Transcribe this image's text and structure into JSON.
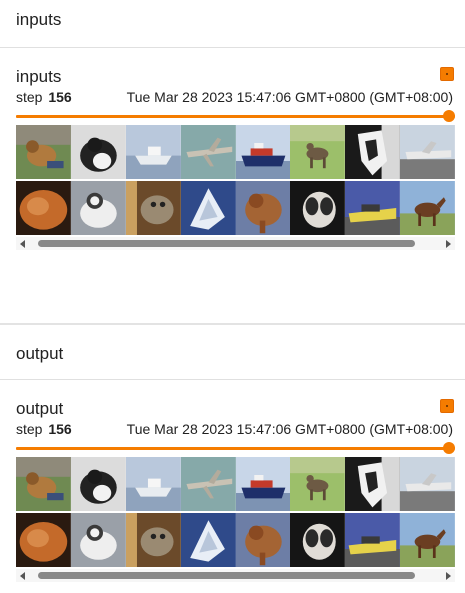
{
  "sections": [
    {
      "header": "inputs",
      "card": {
        "title": "inputs",
        "step_label": "step",
        "step_value": "156",
        "timestamp": "Tue Mar 28 2023 15:47:06 GMT+0800 (GMT+08:00)",
        "slider_fraction": 1.0,
        "images": [
          "dog on grass",
          "black and white dog",
          "boat",
          "airplane",
          "ship",
          "deer",
          "horse",
          "airplane",
          "orange cat",
          "white cat",
          "tabby cat",
          "white boat",
          "brown dog",
          "dog",
          "yellow car",
          "horse"
        ]
      }
    },
    {
      "header": "output",
      "card": {
        "title": "output",
        "step_label": "step",
        "step_value": "156",
        "timestamp": "Tue Mar 28 2023 15:47:06 GMT+0800 (GMT+08:00)",
        "slider_fraction": 1.0,
        "images": [
          "dog on grass",
          "black and white dog",
          "boat",
          "airplane",
          "ship",
          "deer",
          "horse",
          "airplane",
          "orange cat",
          "white cat",
          "tabby cat",
          "white boat",
          "brown dog",
          "dog",
          "yellow car",
          "horse"
        ]
      }
    }
  ],
  "colors": {
    "accent": "#f57c00",
    "scrollbar_thumb": "#888888"
  },
  "icons": {
    "pin": "pin-icon",
    "scroll_left": "arrow-left-icon",
    "scroll_right": "arrow-right-icon"
  }
}
